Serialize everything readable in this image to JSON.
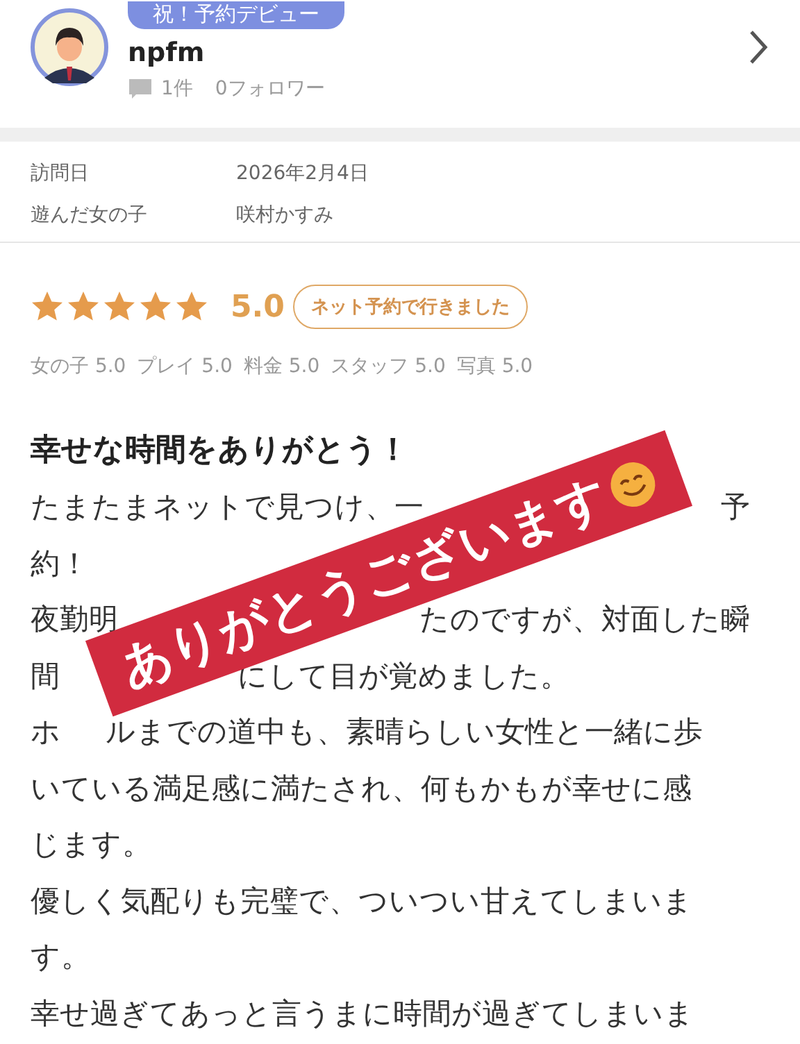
{
  "profile": {
    "badge": "祝！予約デビュー",
    "name": "npfm",
    "review_count": "1件",
    "followers": "0フォロワー"
  },
  "visit": [
    {
      "label": "訪問日",
      "value": "2026年2月4日"
    },
    {
      "label": "遊んだ女の子",
      "value": "咲村かすみ"
    }
  ],
  "rating": {
    "stars": 5,
    "score": "5.0",
    "tag": "ネット予約で行きました",
    "details": [
      "女の子 5.0",
      "プレイ 5.0",
      "料金 5.0",
      "スタッフ 5.0",
      "写真 5.0"
    ]
  },
  "review": {
    "title": "幸せな時間をありがとう！",
    "lines": [
      {
        "segments": [
          "たまたまネットで見つけ、一",
          "予"
        ]
      },
      {
        "segments": [
          "約！"
        ]
      },
      {
        "segments": [
          "夜勤明",
          "たのですが、対面した瞬"
        ]
      },
      {
        "segments": [
          "間",
          "にして目が覚めました。"
        ]
      },
      {
        "segments": [
          "ホ",
          "ルまでの道中も、素晴らしい女性と一緒に歩"
        ]
      },
      {
        "segments": [
          "いている満足感に満たされ、何もかもが幸せに感"
        ]
      },
      {
        "segments": [
          "じます。"
        ]
      },
      {
        "segments": [
          "優しく気配りも完璧で、ついつい甘えてしまいま"
        ]
      },
      {
        "segments": [
          "す。"
        ]
      },
      {
        "segments": [
          "幸せ過ぎてあっと言うまに時間が過ぎてしまいま"
        ]
      }
    ]
  },
  "stamp": {
    "text": "ありがとうございます"
  }
}
